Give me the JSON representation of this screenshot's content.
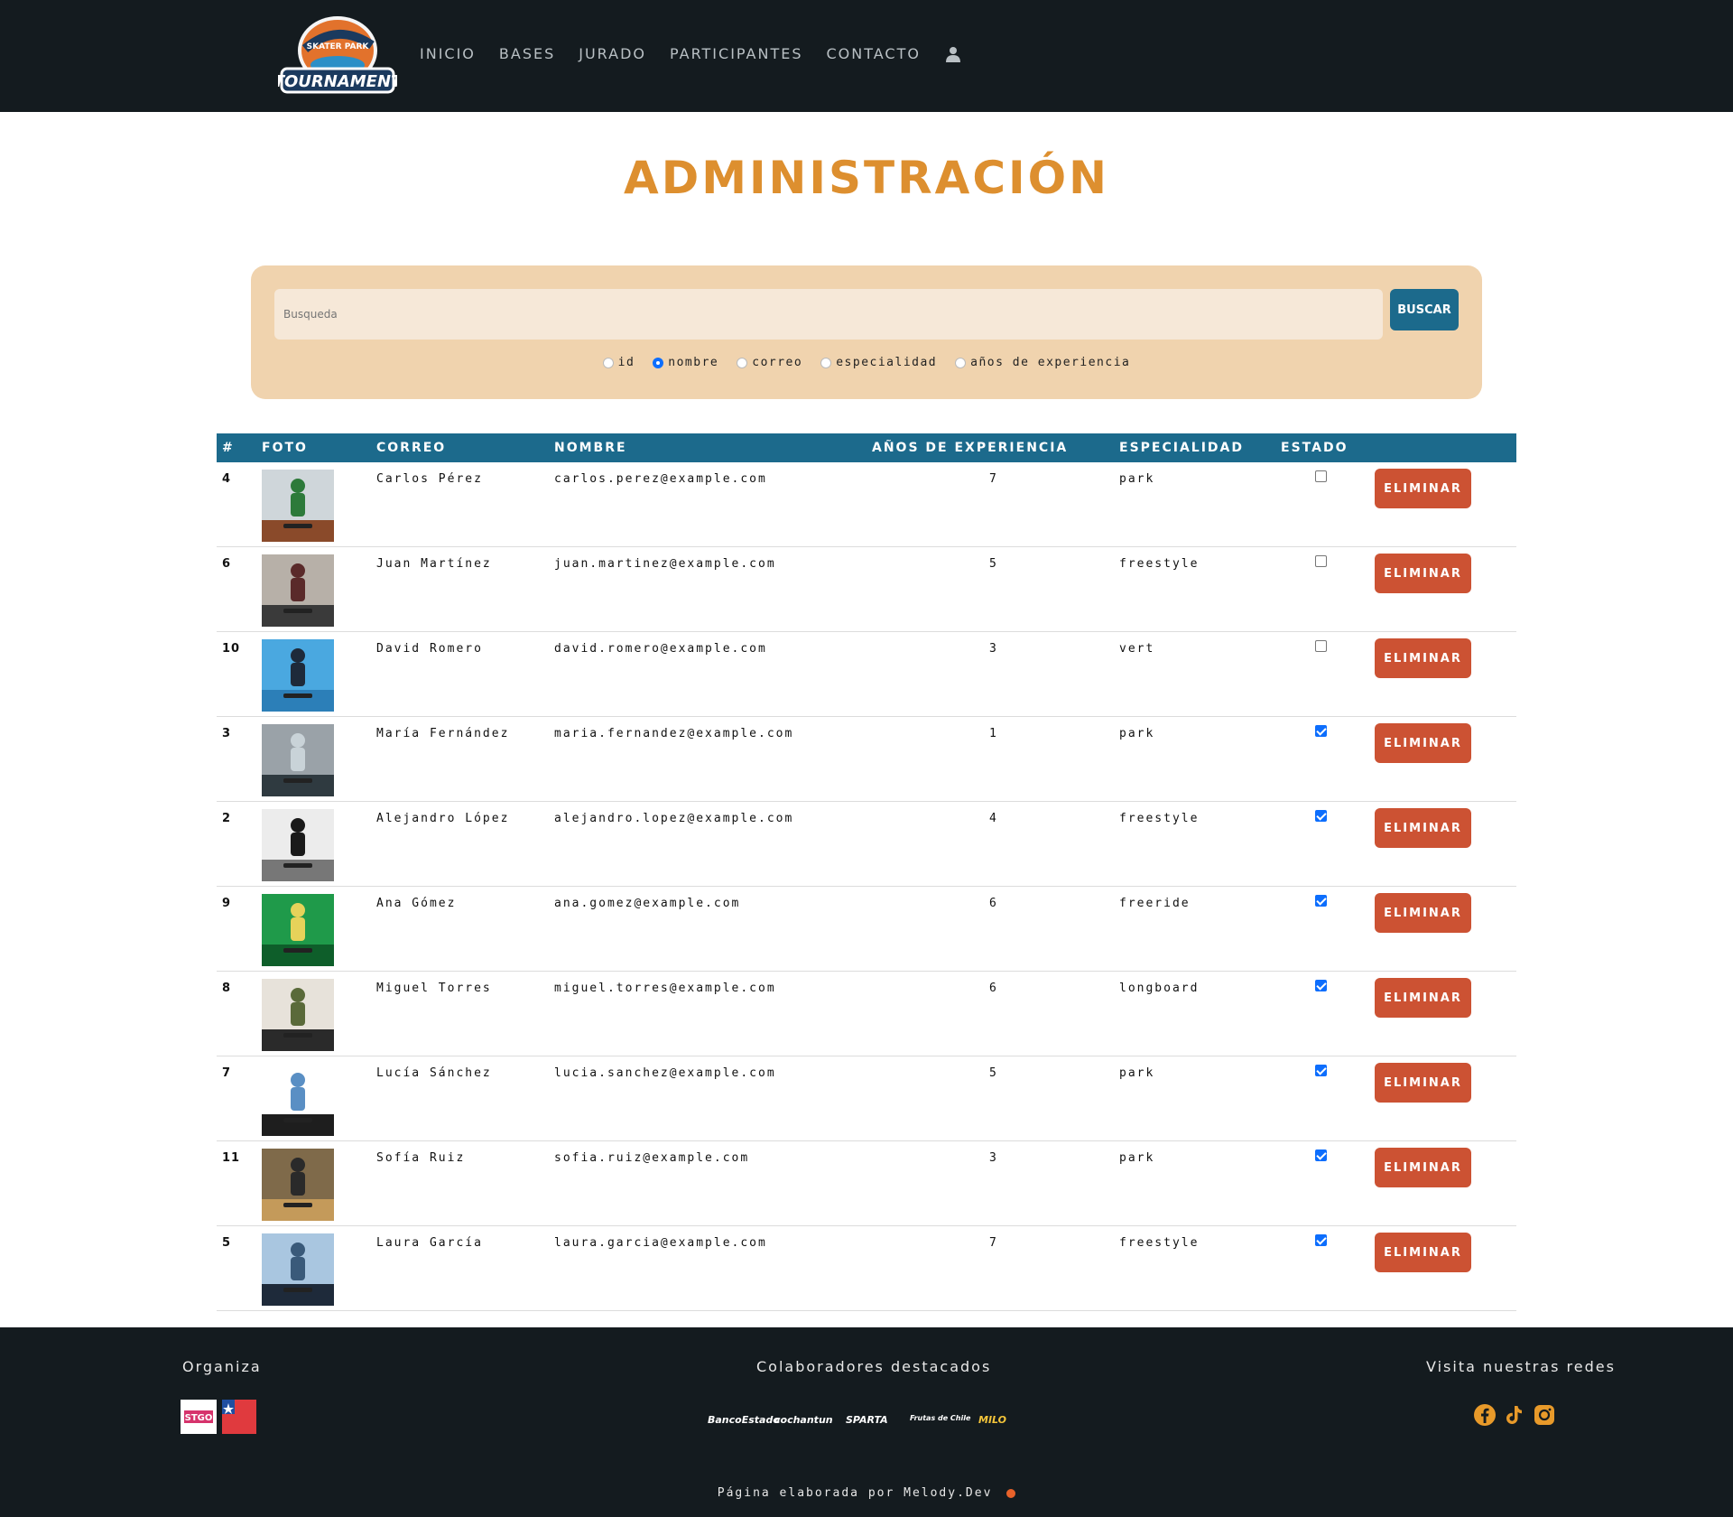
{
  "colors": {
    "nav_bg": "#141b1f",
    "title": "#dd8f2f",
    "panel_bg": "#f0d3ae",
    "input_bg": "#f6e8d8",
    "table_header": "#1c6a8c",
    "search_button": "#1c6a8c",
    "delete_button": "#cc5233",
    "social_icon": "#e89a2a"
  },
  "nav": {
    "logo_text": [
      "SKATER PARK",
      "TOURNAMENT"
    ],
    "links": [
      "INICIO",
      "BASES",
      "JURADO",
      "PARTICIPANTES",
      "CONTACTO"
    ],
    "user_icon": "user-icon"
  },
  "title": "ADMINISTRACIÓN",
  "search": {
    "placeholder": "Busqueda",
    "button": "BUSCAR",
    "options": [
      {
        "label": "id",
        "selected": false
      },
      {
        "label": "nombre",
        "selected": true
      },
      {
        "label": "correo",
        "selected": false
      },
      {
        "label": "especialidad",
        "selected": false
      },
      {
        "label": "años de experiencia",
        "selected": false
      }
    ]
  },
  "table": {
    "headers": [
      "#",
      "FOTO",
      "CORREO",
      "NOMBRE",
      "AÑOS DE EXPERIENCIA",
      "ESPECIALIDAD",
      "ESTADO"
    ],
    "delete_label": "ELIMINAR",
    "rows": [
      {
        "id": "4",
        "name": "Carlos Pérez",
        "email": "carlos.perez@example.com",
        "years": "7",
        "specialty": "park",
        "active": false
      },
      {
        "id": "6",
        "name": "Juan Martínez",
        "email": "juan.martinez@example.com",
        "years": "5",
        "specialty": "freestyle",
        "active": false
      },
      {
        "id": "10",
        "name": "David Romero",
        "email": "david.romero@example.com",
        "years": "3",
        "specialty": "vert",
        "active": false
      },
      {
        "id": "3",
        "name": "María Fernández",
        "email": "maria.fernandez@example.com",
        "years": "1",
        "specialty": "park",
        "active": true
      },
      {
        "id": "2",
        "name": "Alejandro López",
        "email": "alejandro.lopez@example.com",
        "years": "4",
        "specialty": "freestyle",
        "active": true
      },
      {
        "id": "9",
        "name": "Ana Gómez",
        "email": "ana.gomez@example.com",
        "years": "6",
        "specialty": "freeride",
        "active": true
      },
      {
        "id": "8",
        "name": "Miguel Torres",
        "email": "miguel.torres@example.com",
        "years": "6",
        "specialty": "longboard",
        "active": true
      },
      {
        "id": "7",
        "name": "Lucía Sánchez",
        "email": "lucia.sanchez@example.com",
        "years": "5",
        "specialty": "park",
        "active": true
      },
      {
        "id": "11",
        "name": "Sofía Ruiz",
        "email": "sofia.ruiz@example.com",
        "years": "3",
        "specialty": "park",
        "active": true
      },
      {
        "id": "5",
        "name": "Laura García",
        "email": "laura.garcia@example.com",
        "years": "7",
        "specialty": "freestyle",
        "active": true
      }
    ]
  },
  "footer": {
    "organiza": "Organiza",
    "org_logos": [
      "STGO",
      "gobierno-de-chile-logo"
    ],
    "colaboradores": "Colaboradores destacados",
    "sponsors": [
      "BancoEstado",
      "cochantun",
      "SPARTA",
      "Frutas de Chile",
      "MILO"
    ],
    "redes": "Visita nuestras redes",
    "social": [
      "facebook-icon",
      "tiktok-icon",
      "instagram-icon"
    ],
    "credit": "Página elaborada por Melody.Dev"
  }
}
